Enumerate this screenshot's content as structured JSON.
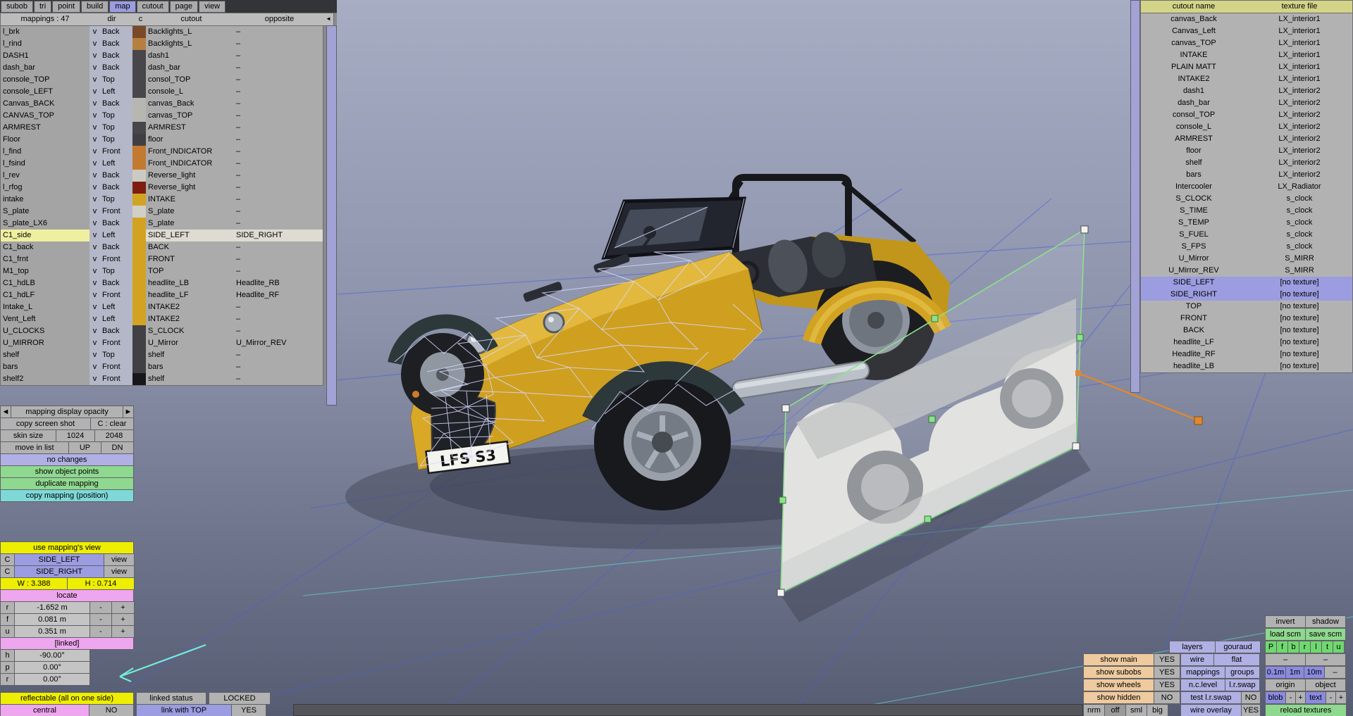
{
  "menu": {
    "items": [
      {
        "label": "subob"
      },
      {
        "label": "tri"
      },
      {
        "label": "point"
      },
      {
        "label": "build"
      },
      {
        "label": "map",
        "selected": true
      },
      {
        "label": "cutout"
      },
      {
        "label": "page"
      },
      {
        "label": "view"
      }
    ]
  },
  "mappings_table": {
    "header": {
      "name": "mappings : 47",
      "dir": "dir",
      "c": "c",
      "cutout": "cutout",
      "opposite": "opposite",
      "collapse": "◄"
    },
    "rows": [
      {
        "name": "l_brk",
        "v": "v",
        "dir": "Back",
        "swatch": "#7a4a28",
        "cutout": "Backlights_L",
        "opposite": "–"
      },
      {
        "name": "l_rind",
        "v": "v",
        "dir": "Back",
        "swatch": "#b5803f",
        "cutout": "Backlights_L",
        "opposite": "–"
      },
      {
        "name": "DASH1",
        "v": "v",
        "dir": "Back",
        "swatch": "#47474b",
        "cutout": "dash1",
        "opposite": "–"
      },
      {
        "name": "dash_bar",
        "v": "v",
        "dir": "Back",
        "swatch": "#47474b",
        "cutout": "dash_bar",
        "opposite": "–"
      },
      {
        "name": "console_TOP",
        "v": "v",
        "dir": "Top",
        "swatch": "#47474b",
        "cutout": "consol_TOP",
        "opposite": "–"
      },
      {
        "name": "console_LEFT",
        "v": "v",
        "dir": "Left",
        "swatch": "#47474b",
        "cutout": "console_L",
        "opposite": "–"
      },
      {
        "name": "Canvas_BACK",
        "v": "v",
        "dir": "Back",
        "swatch": "#b7b7b1",
        "cutout": "canvas_Back",
        "opposite": "–"
      },
      {
        "name": "CANVAS_TOP",
        "v": "v",
        "dir": "Top",
        "swatch": "#b7b7b1",
        "cutout": "canvas_TOP",
        "opposite": "–"
      },
      {
        "name": "ARMREST",
        "v": "v",
        "dir": "Top",
        "swatch": "#47474b",
        "cutout": "ARMREST",
        "opposite": "–"
      },
      {
        "name": "Floor",
        "v": "v",
        "dir": "Top",
        "swatch": "#3f3f42",
        "cutout": "floor",
        "opposite": "–"
      },
      {
        "name": "l_find",
        "v": "v",
        "dir": "Front",
        "swatch": "#c27a31",
        "cutout": "Front_INDICATOR",
        "opposite": "–"
      },
      {
        "name": "l_fsind",
        "v": "v",
        "dir": "Left",
        "swatch": "#c27a31",
        "cutout": "Front_INDICATOR",
        "opposite": "–"
      },
      {
        "name": "l_rev",
        "v": "v",
        "dir": "Back",
        "swatch": "#cbcbc3",
        "cutout": "Reverse_light",
        "opposite": "–"
      },
      {
        "name": "l_rfog",
        "v": "v",
        "dir": "Back",
        "swatch": "#7e1c12",
        "cutout": "Reverse_light",
        "opposite": "–"
      },
      {
        "name": "intake",
        "v": "v",
        "dir": "Top",
        "swatch": "#d2a322",
        "cutout": "INTAKE",
        "opposite": "–"
      },
      {
        "name": "S_plate",
        "v": "v",
        "dir": "Front",
        "swatch": "#d0d0c8",
        "cutout": "S_plate",
        "opposite": "–"
      },
      {
        "name": "S_plate_LX6",
        "v": "v",
        "dir": "Back",
        "swatch": "#d2a322",
        "cutout": "S_plate",
        "opposite": "–"
      },
      {
        "name": "C1_side",
        "v": "v",
        "dir": "Left",
        "swatch": "#d2a322",
        "cutout": "SIDE_LEFT",
        "opposite": "SIDE_RIGHT",
        "selected": true
      },
      {
        "name": "C1_back",
        "v": "v",
        "dir": "Back",
        "swatch": "#d2a322",
        "cutout": "BACK",
        "opposite": "–"
      },
      {
        "name": "C1_frnt",
        "v": "v",
        "dir": "Front",
        "swatch": "#d2a322",
        "cutout": "FRONT",
        "opposite": "–"
      },
      {
        "name": "M1_top",
        "v": "v",
        "dir": "Top",
        "swatch": "#d2a322",
        "cutout": "TOP",
        "opposite": "–"
      },
      {
        "name": "C1_hdLB",
        "v": "v",
        "dir": "Back",
        "swatch": "#d2a322",
        "cutout": "headlite_LB",
        "opposite": "Headlite_RB"
      },
      {
        "name": "C1_hdLF",
        "v": "v",
        "dir": "Front",
        "swatch": "#d2a322",
        "cutout": "headlite_LF",
        "opposite": "Headlite_RF"
      },
      {
        "name": "Intake_L",
        "v": "v",
        "dir": "Left",
        "swatch": "#d2a322",
        "cutout": "INTAKE2",
        "opposite": "–"
      },
      {
        "name": "Vent_Left",
        "v": "v",
        "dir": "Left",
        "swatch": "#d2a322",
        "cutout": "INTAKE2",
        "opposite": "–"
      },
      {
        "name": "U_CLOCKS",
        "v": "v",
        "dir": "Back",
        "swatch": "#404045",
        "cutout": "S_CLOCK",
        "opposite": "–"
      },
      {
        "name": "U_MIRROR",
        "v": "v",
        "dir": "Front",
        "swatch": "#404045",
        "cutout": "U_Mirror",
        "opposite": "U_Mirror_REV"
      },
      {
        "name": "shelf",
        "v": "v",
        "dir": "Top",
        "swatch": "#404045",
        "cutout": "shelf",
        "opposite": "–"
      },
      {
        "name": "bars",
        "v": "v",
        "dir": "Front",
        "swatch": "#404045",
        "cutout": "bars",
        "opposite": "–"
      },
      {
        "name": "shelf2",
        "v": "v",
        "dir": "Front",
        "swatch": "#17171a",
        "cutout": "shelf",
        "opposite": "–"
      }
    ]
  },
  "cutouts_table": {
    "header": {
      "cutout": "cutout name",
      "texture": "texture file"
    },
    "rows": [
      {
        "cutout": "canvas_Back",
        "texture": "LX_interior1"
      },
      {
        "cutout": "Canvas_Left",
        "texture": "LX_interior1"
      },
      {
        "cutout": "canvas_TOP",
        "texture": "LX_interior1"
      },
      {
        "cutout": "INTAKE",
        "texture": "LX_interior1"
      },
      {
        "cutout": "PLAIN MATT",
        "texture": "LX_interior1"
      },
      {
        "cutout": "INTAKE2",
        "texture": "LX_interior1"
      },
      {
        "cutout": "dash1",
        "texture": "LX_interior2"
      },
      {
        "cutout": "dash_bar",
        "texture": "LX_interior2"
      },
      {
        "cutout": "consol_TOP",
        "texture": "LX_interior2"
      },
      {
        "cutout": "console_L",
        "texture": "LX_interior2"
      },
      {
        "cutout": "ARMREST",
        "texture": "LX_interior2"
      },
      {
        "cutout": "floor",
        "texture": "LX_interior2"
      },
      {
        "cutout": "shelf",
        "texture": "LX_interior2"
      },
      {
        "cutout": "bars",
        "texture": "LX_interior2"
      },
      {
        "cutout": "Intercooler",
        "texture": "LX_Radiator"
      },
      {
        "cutout": "S_CLOCK",
        "texture": "s_clock"
      },
      {
        "cutout": "S_TIME",
        "texture": "s_clock"
      },
      {
        "cutout": "S_TEMP",
        "texture": "s_clock"
      },
      {
        "cutout": "S_FUEL",
        "texture": "s_clock"
      },
      {
        "cutout": "S_FPS",
        "texture": "s_clock"
      },
      {
        "cutout": "U_Mirror",
        "texture": "S_MIRR"
      },
      {
        "cutout": "U_Mirror_REV",
        "texture": "S_MIRR"
      },
      {
        "cutout": "SIDE_LEFT",
        "texture": "[no texture]",
        "selected": true
      },
      {
        "cutout": "SIDE_RIGHT",
        "texture": "[no texture]",
        "selected": true
      },
      {
        "cutout": "TOP",
        "texture": "[no texture]"
      },
      {
        "cutout": "FRONT",
        "texture": "[no texture]"
      },
      {
        "cutout": "BACK",
        "texture": "[no texture]"
      },
      {
        "cutout": "headlite_LF",
        "texture": "[no texture]"
      },
      {
        "cutout": "Headlite_RF",
        "texture": "[no texture]"
      },
      {
        "cutout": "headlite_LB",
        "texture": "[no texture]"
      }
    ]
  },
  "panel_left": {
    "opacity_prev": "◄",
    "opacity_label": "mapping display opacity",
    "opacity_next": "►",
    "copy_screen_shot": "copy screen shot",
    "clear": "C : clear",
    "skin_size": "skin size",
    "size_1024": "1024",
    "size_2048": "2048",
    "move_in_list": "move in list",
    "up": "UP",
    "dn": "DN",
    "no_changes": "no changes",
    "show_object_points": "show object points",
    "duplicate_mapping": "duplicate mapping",
    "copy_mapping_position": "copy mapping (position)",
    "use_mappings_view": "use mapping's view",
    "c1": "C",
    "side_left": "SIDE_LEFT",
    "view1": "view",
    "c2": "C",
    "side_right": "SIDE_RIGHT",
    "view2": "view",
    "w": "W : 3.388",
    "h": "H : 0.714",
    "locate": "locate",
    "locate_axes": [
      {
        "label": "r",
        "value": "-1.652 m",
        "minus": "-",
        "plus": "+"
      },
      {
        "label": "f",
        "value": "0.081 m",
        "minus": "-",
        "plus": "+"
      },
      {
        "label": "u",
        "value": "0.351 m",
        "minus": "-",
        "plus": "+"
      }
    ],
    "linked": "[linked]",
    "angles": [
      {
        "label": "h",
        "value": "-90.00°"
      },
      {
        "label": "p",
        "value": "0.00°"
      },
      {
        "label": "r",
        "value": "0.00°"
      }
    ],
    "reflectable": "reflectable (all on one side)",
    "linked_status": "linked status",
    "locked": "LOCKED",
    "central": "central",
    "central_val": "NO",
    "link_with_top": "link with TOP",
    "link_with_top_val": "YES"
  },
  "panel_br": {
    "invert": "invert",
    "shadow": "shadow",
    "load_scm": "load scm",
    "save_scm": "save scm",
    "proj": [
      "P",
      "f",
      "b",
      "r",
      "l",
      "t",
      "u"
    ],
    "layers": "layers",
    "gouraud": "gouraud",
    "show_main": "show main",
    "show_main_val": "YES",
    "wire": "wire",
    "flat": "flat",
    "dash1": "–",
    "dash2": "–",
    "show_subobs": "show subobs",
    "show_subobs_val": "YES",
    "mappings": "mappings",
    "groups": "groups",
    "m01": "0.1m",
    "m1": "1m",
    "m10": "10m",
    "dash3": "–",
    "show_wheels": "show wheels",
    "show_wheels_val": "YES",
    "nclevel": "n.c.level",
    "lrswap": "l.r.swap",
    "origin": "origin",
    "object": "object",
    "show_hidden": "show hidden",
    "show_hidden_val": "NO",
    "test_lrswap": "test l.r.swap",
    "test_lrswap_val": "NO",
    "blob": "blob",
    "blob_minus": "-",
    "blob_plus": "+",
    "text": "text",
    "text_minus": "-",
    "text_plus": "+",
    "nrm": "nrm",
    "off": "off",
    "sml": "sml",
    "big": "big",
    "wire_overlay": "wire overlay",
    "wire_overlay_val": "YES",
    "reload_textures": "reload textures"
  },
  "viewport": {
    "license_plate": "LFS S3",
    "car_color": "#d2a322",
    "plane_outline_color": "#8fe08f",
    "corner_handle_color": "#f2f2f2",
    "mid_handle_color": "#8fe08f",
    "gizmo_color": "#e08830",
    "grid_color": "#4a5fd8",
    "arrow_color": "#74ecdc"
  }
}
